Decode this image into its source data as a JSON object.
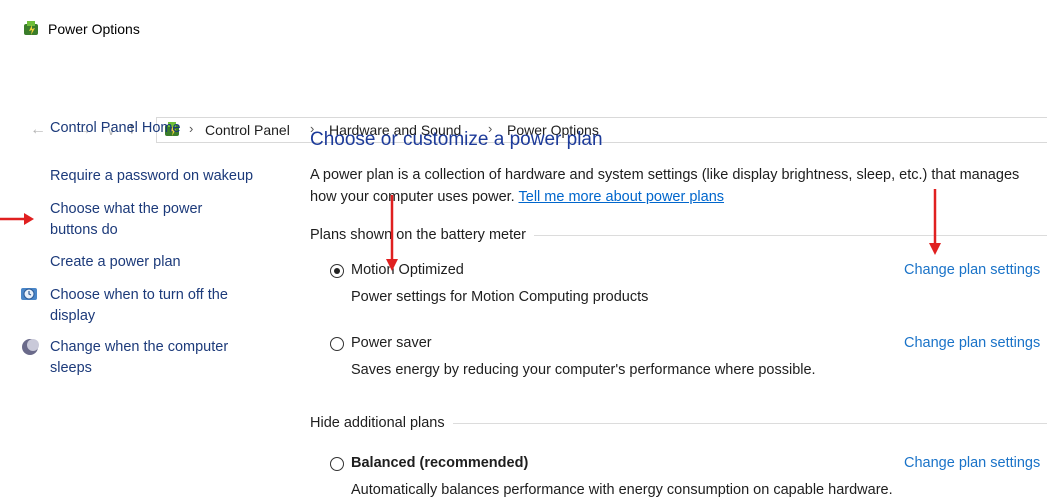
{
  "window": {
    "title": "Power Options",
    "icon": "power-options-icon"
  },
  "nav": {
    "back_icon": "back-arrow-icon",
    "forward_icon": "forward-arrow-icon",
    "history_icon": "chevron-down-icon",
    "up_icon": "up-arrow-icon"
  },
  "breadcrumb": [
    "Control Panel",
    "Hardware and Sound",
    "Power Options"
  ],
  "left_pane": {
    "home": "Control Panel Home",
    "items": [
      "Require a password on wakeup",
      "Choose what the power\nbuttons do",
      "Create a power plan",
      "Choose when to turn off the\ndisplay",
      "Change when the computer\nsleeps"
    ],
    "item_lines": [
      [
        "Require a password on wakeup"
      ],
      [
        "Choose what the power",
        "buttons do"
      ],
      [
        "Create a power plan"
      ],
      [
        "Choose when to turn off the",
        "display"
      ],
      [
        "Change when the computer",
        "sleeps"
      ]
    ]
  },
  "main": {
    "heading": "Choose or customize a power plan",
    "description": "A power plan is a collection of hardware and system settings (like display brightness, sleep, etc.) that manages how your computer uses power.",
    "description_link": "Tell me more about power plans",
    "group_battery": "Plans shown on the battery meter",
    "group_additional": "Hide additional plans",
    "plans": [
      {
        "name": "Motion Optimized",
        "description": "Power settings for Motion Computing products",
        "selected": true,
        "link": "Change plan settings"
      },
      {
        "name": "Power saver",
        "description": "Saves energy by reducing your computer's performance where possible.",
        "selected": false,
        "link": "Change plan settings"
      },
      {
        "name": "Balanced (recommended)",
        "description": "Automatically balances performance with energy consumption on capable hardware.",
        "selected": false,
        "link": "Change plan settings"
      }
    ]
  },
  "annotation_color": "#e02020",
  "link_color": "#1a73c8",
  "heading_color": "#1c3a99"
}
